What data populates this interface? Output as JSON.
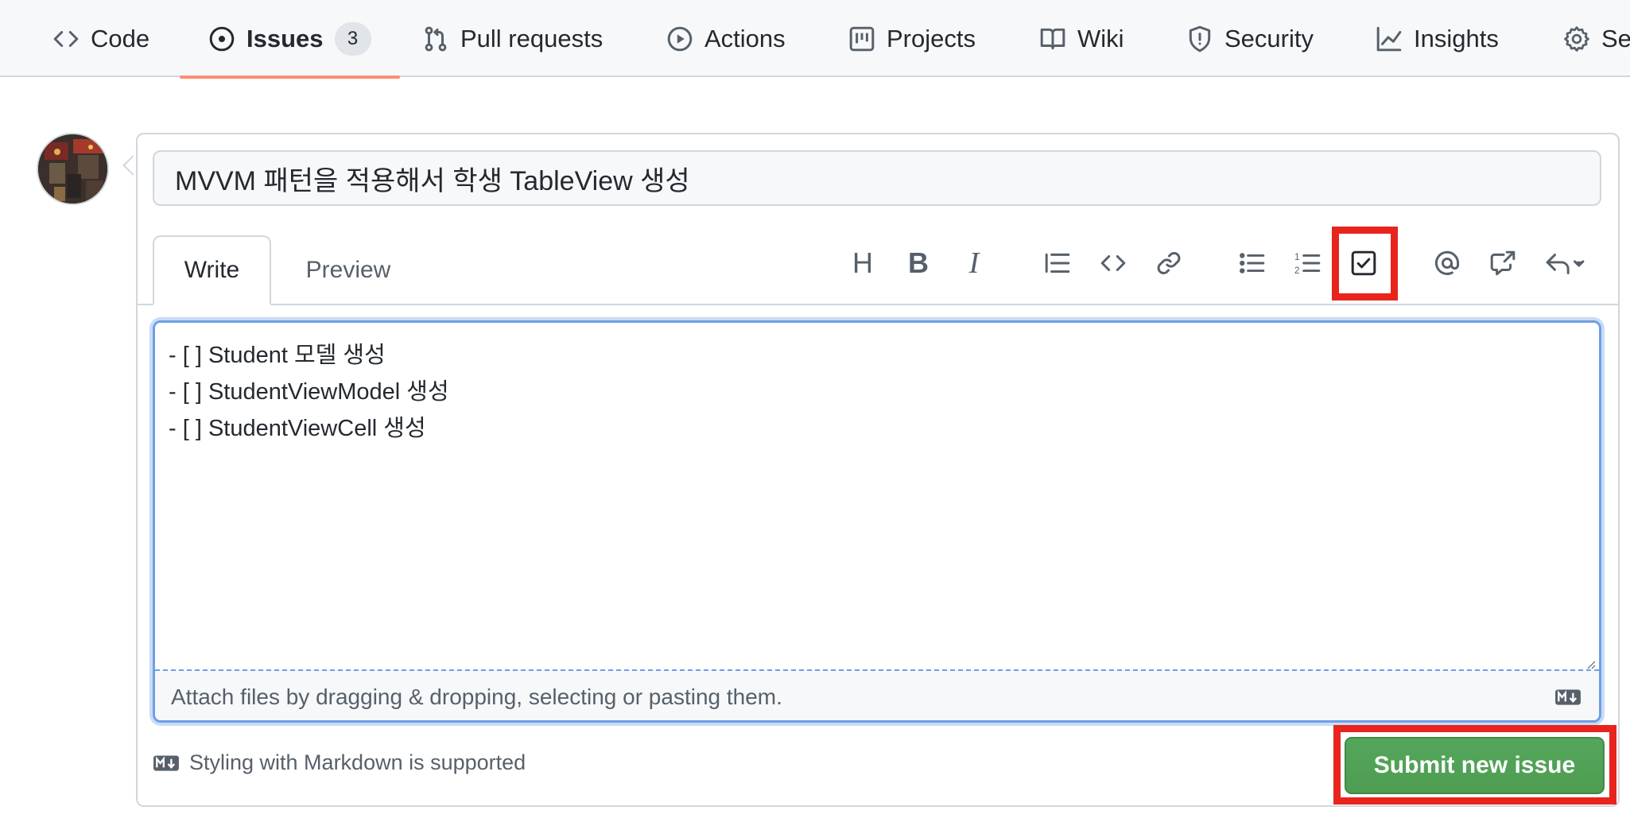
{
  "repo_nav": {
    "tabs": [
      {
        "label": "Code",
        "icon": "code-icon"
      },
      {
        "label": "Issues",
        "icon": "issue-opened-icon",
        "count": "3",
        "selected": true
      },
      {
        "label": "Pull requests",
        "icon": "git-pull-request-icon"
      },
      {
        "label": "Actions",
        "icon": "play-icon"
      },
      {
        "label": "Projects",
        "icon": "project-icon"
      },
      {
        "label": "Wiki",
        "icon": "book-icon"
      },
      {
        "label": "Security",
        "icon": "shield-icon"
      },
      {
        "label": "Insights",
        "icon": "graph-icon"
      },
      {
        "label": "Se",
        "icon": "gear-icon"
      }
    ],
    "selected_underline_color": "#fd8c73"
  },
  "issue_form": {
    "title_value": "MVVM 패턴을 적용해서 학생 TableView 생성",
    "tabs": {
      "write": "Write",
      "preview": "Preview"
    },
    "toolbar": [
      "heading-icon",
      "bold-icon",
      "italic-icon",
      "quote-icon",
      "code-icon",
      "link-icon",
      "unordered-list-icon",
      "ordered-list-icon",
      "task-list-icon",
      "mention-icon",
      "cross-reference-icon",
      "reply-icon"
    ],
    "highlighted_tool": "task-list-icon",
    "body_value": "- [ ] Student 모델 생성\n- [ ] StudentViewModel 생성\n- [ ] StudentViewCell 생성",
    "attach_text": "Attach files by dragging & dropping, selecting or pasting them.",
    "markdown_note": "Styling with Markdown is supported",
    "submit_label": "Submit new issue",
    "colors": {
      "submit": "#4e9d52",
      "highlight": "#e8241d",
      "focus_border": "#6e9fe6"
    }
  }
}
